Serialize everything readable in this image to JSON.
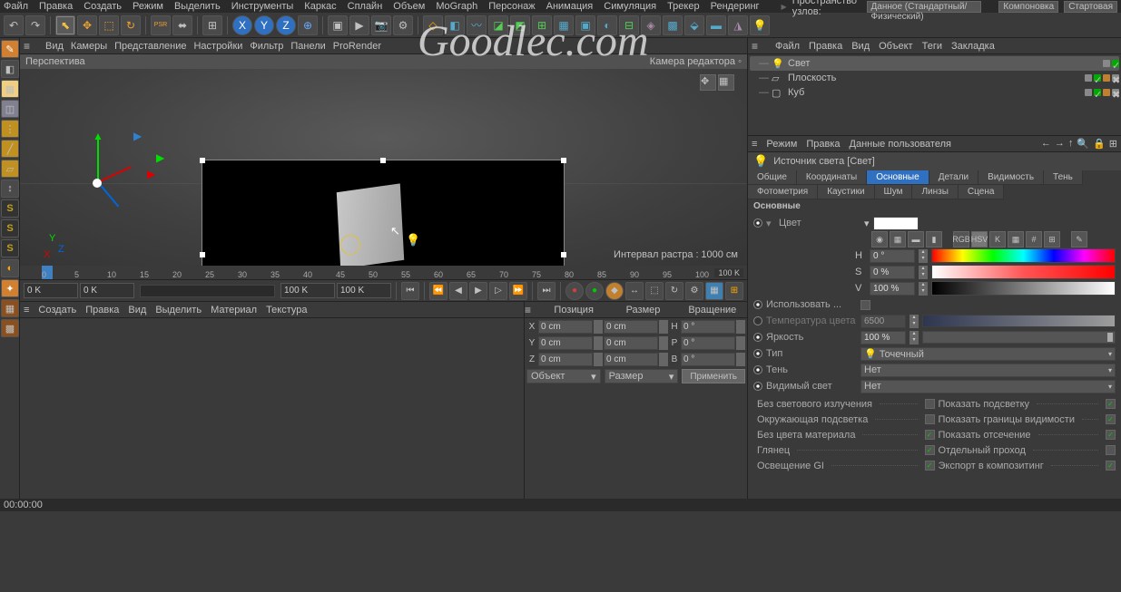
{
  "topmenu": {
    "items": [
      "Файл",
      "Правка",
      "Создать",
      "Режим",
      "Выделить",
      "Инструменты",
      "Каркас",
      "Сплайн",
      "Объем",
      "MoGraph",
      "Персонаж",
      "Анимация",
      "Симуляция",
      "Трекер",
      "Рендеринг"
    ],
    "nodespace_label": "Пространство узлов:",
    "nodespace_value": "Данное (Стандартный/Физический)",
    "layout_btn": "Компоновка",
    "start_btn": "Стартовая"
  },
  "toolbar_icons": [
    "↶",
    "↷",
    "⤢",
    "⬌",
    "✥",
    "↻",
    "⬜",
    "⬛",
    "P S R",
    "⬌",
    "⬍",
    "↻",
    "X",
    "Y",
    "Z",
    "◉",
    "🔒",
    "⬜",
    "▶",
    "📷",
    "🎬",
    "⚙",
    "⬛",
    "◈",
    "◈",
    "◈",
    "◈",
    "◈",
    "◈",
    "◈",
    "◈",
    "◈",
    "◈",
    "◈",
    "◈",
    "◈",
    "◈",
    "💡"
  ],
  "vptabs": [
    "Вид",
    "Камеры",
    "Представление",
    "Настройки",
    "Фильтр",
    "Панели",
    "ProRender"
  ],
  "vp": {
    "persp": "Перспектива",
    "camera": "Камера редактора",
    "grid_label": "Интервал растра :",
    "grid_value": "1000 см"
  },
  "timeline": {
    "ticks": [
      "0",
      "5",
      "10",
      "15",
      "20",
      "25",
      "30",
      "35",
      "40",
      "45",
      "50",
      "55",
      "60",
      "65",
      "70",
      "75",
      "80",
      "85",
      "90",
      "95",
      "100"
    ],
    "end": "100 K",
    "start": "0 K",
    "f1": "0 K",
    "f2": "100 K",
    "f3": "100 K"
  },
  "mat_menu": [
    "Создать",
    "Правка",
    "Вид",
    "Выделить",
    "Материал",
    "Текстура"
  ],
  "coord": {
    "headers": [
      "Позиция",
      "Размер",
      "Вращение"
    ],
    "rows": [
      {
        "ax": "X",
        "p": "0 cm",
        "s": "0 cm",
        "r_lbl": "H",
        "r": "0 °"
      },
      {
        "ax": "Y",
        "p": "0 cm",
        "s": "0 cm",
        "r_lbl": "P",
        "r": "0 °"
      },
      {
        "ax": "Z",
        "p": "0 cm",
        "s": "0 cm",
        "r_lbl": "B",
        "r": "0 °"
      }
    ],
    "obj": "Объект",
    "size": "Размер",
    "apply": "Применить"
  },
  "obj_menu": [
    "Файл",
    "Правка",
    "Вид",
    "Объект",
    "Теги",
    "Закладка"
  ],
  "objects": [
    {
      "name": "Свет",
      "icon": "💡",
      "sel": true
    },
    {
      "name": "Плоскость",
      "icon": "▱",
      "sel": false
    },
    {
      "name": "Куб",
      "icon": "▢",
      "sel": false
    }
  ],
  "attr_menu": [
    "Режим",
    "Правка",
    "Данные пользователя"
  ],
  "attr": {
    "title": "Источник света [Свет]",
    "tabs": [
      "Общие",
      "Координаты",
      "Основные",
      "Детали",
      "Видимость",
      "Тень",
      "Фотометрия"
    ],
    "tabs2": [
      "Каустики",
      "Шум",
      "Линзы",
      "Сцена"
    ],
    "active": 2,
    "section": "Основные",
    "color_label": "Цвет",
    "H_lbl": "H",
    "H_val": "0 °",
    "S_lbl": "S",
    "S_val": "0 %",
    "V_lbl": "V",
    "V_val": "100 %",
    "use_label": "Использовать ...",
    "temp_label": "Температура цвета",
    "temp_val": "6500",
    "bright_label": "Яркость",
    "bright_val": "100 %",
    "type_label": "Тип",
    "type_val": "Точечный",
    "shadow_label": "Тень",
    "shadow_val": "Нет",
    "vis_label": "Видимый свет",
    "vis_val": "Нет",
    "checks": [
      {
        "l": "Без светового излучения",
        "lc": false,
        "r": "Показать подсветку",
        "rc": true
      },
      {
        "l": "Окружающая подсветка",
        "lc": false,
        "r": "Показать границы видимости",
        "rc": true
      },
      {
        "l": "Без цвета материала",
        "lc": true,
        "r": "Показать отсечение",
        "rc": true
      },
      {
        "l": "Глянец",
        "lc": true,
        "r": "Отдельный проход",
        "rc": false
      },
      {
        "l": "Освещение GI",
        "lc": true,
        "r": "Экспорт в композитинг",
        "rc": true
      }
    ]
  },
  "status": {
    "time": "00:00:00"
  },
  "watermark": "Goodlec.com"
}
